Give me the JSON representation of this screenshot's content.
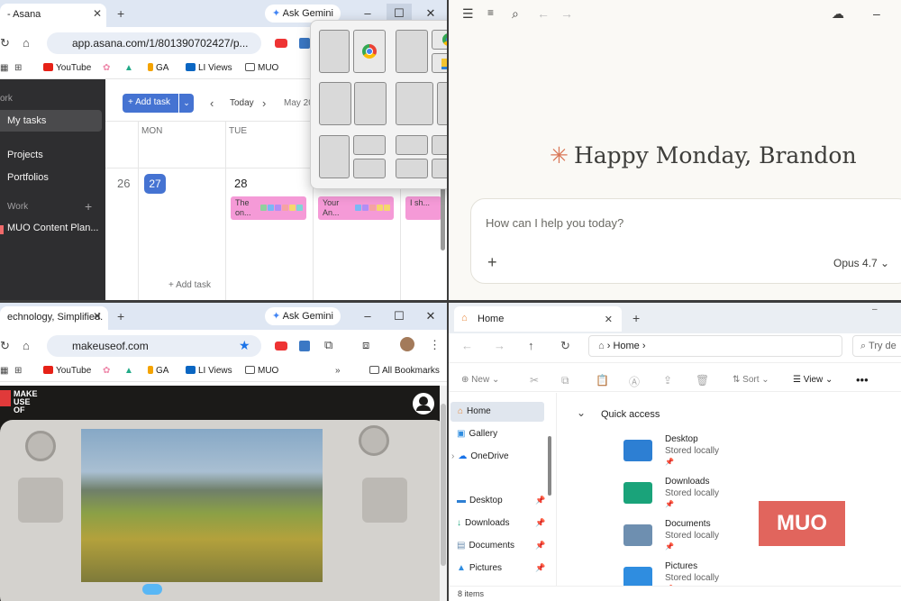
{
  "asana_window": {
    "tab_title": "- Asana",
    "url": "app.asana.com/1/801390702427/p...",
    "bookmarks": [
      "YouTube",
      "GA",
      "LI Views",
      "MUO"
    ],
    "sidebar": {
      "work_header": "ork",
      "my_tasks": "My tasks",
      "projects": "Projects",
      "portfolios": "Portfolios",
      "work_section": "Work",
      "project_item": "MUO Content Plan..."
    },
    "toolbar": {
      "add_task": "Add task",
      "today": "Today",
      "date": "May 20"
    },
    "columns": [
      "MON",
      "TUE"
    ],
    "days": [
      "26",
      "27",
      "28"
    ],
    "cards": [
      "The on...",
      "Your An...",
      "I sh..."
    ],
    "add_task_link": "Add task"
  },
  "snap_flyout": {},
  "claude_window": {
    "greeting": "Happy Monday, Brandon",
    "input_placeholder": "How can I help you today?",
    "model": "Opus 4.7"
  },
  "muo_window": {
    "tab_title": "echnology, Simplified.",
    "gemini": "Ask Gemini",
    "url": "makeuseof.com",
    "bookmarks": [
      "YouTube",
      "GA",
      "LI Views",
      "MUO"
    ],
    "all_bookmarks": "All Bookmarks",
    "logo_text": "MAKE USE OF"
  },
  "explorer_window": {
    "tab_title": "Home",
    "address": "Home",
    "search_placeholder": "Try de",
    "commands": {
      "new": "New",
      "sort": "Sort",
      "view": "View"
    },
    "nav": [
      "Home",
      "Gallery",
      "OneDrive",
      "Desktop",
      "Downloads",
      "Documents",
      "Pictures"
    ],
    "section": "Quick access",
    "folders": [
      {
        "name": "Desktop",
        "sub": "Stored locally",
        "color": "#2d7fd3"
      },
      {
        "name": "Downloads",
        "sub": "Stored locally",
        "color": "#1aa37a"
      },
      {
        "name": "Documents",
        "sub": "Stored locally",
        "color": "#6e8fb0"
      },
      {
        "name": "Pictures",
        "sub": "Stored locally",
        "color": "#2f8de0"
      }
    ],
    "status": "8 items",
    "watermark": "MUO"
  }
}
